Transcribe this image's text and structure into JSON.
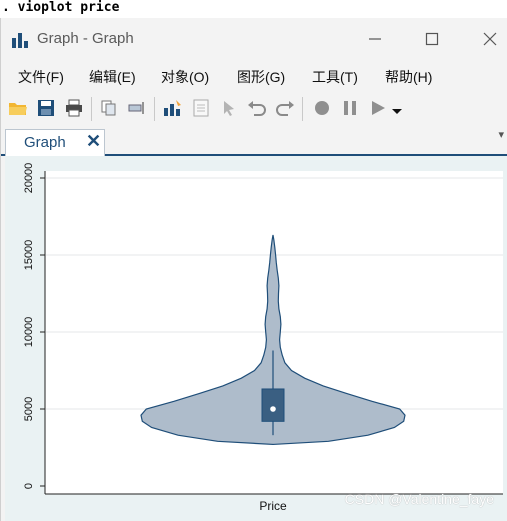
{
  "console": {
    "command": ". vioplot price"
  },
  "window": {
    "title": "Graph - Graph"
  },
  "menu": [
    "文件(F)",
    "编辑(E)",
    "对象(O)",
    "图形(G)",
    "工具(T)",
    "帮助(H)"
  ],
  "tab": {
    "label": "Graph",
    "close": "✕"
  },
  "watermark": "CSDN @Valentine_faye",
  "chart_data": {
    "type": "violin",
    "title": "",
    "xlabel": "Price",
    "ylabel": "",
    "ylim": [
      0,
      20000
    ],
    "yticks": [
      0,
      5000,
      10000,
      15000,
      20000
    ],
    "ytick_labels": [
      "0",
      "5000",
      "10000",
      "15000",
      "20000"
    ],
    "grid": true,
    "series": [
      {
        "name": "Price",
        "box": {
          "q1": 4200,
          "median": 5000,
          "q3": 6300,
          "whisker_low": 3300,
          "whisker_high": 8800
        },
        "density_profile": [
          [
            2700,
            0.0
          ],
          [
            2900,
            0.42
          ],
          [
            3300,
            0.72
          ],
          [
            3800,
            0.92
          ],
          [
            4200,
            0.99
          ],
          [
            4600,
            1.0
          ],
          [
            5000,
            0.96
          ],
          [
            5500,
            0.75
          ],
          [
            6000,
            0.56
          ],
          [
            6500,
            0.38
          ],
          [
            7000,
            0.24
          ],
          [
            7500,
            0.14
          ],
          [
            8000,
            0.09
          ],
          [
            8500,
            0.07
          ],
          [
            9000,
            0.055
          ],
          [
            9500,
            0.05
          ],
          [
            10000,
            0.055
          ],
          [
            10500,
            0.06
          ],
          [
            11000,
            0.055
          ],
          [
            11500,
            0.045
          ],
          [
            12000,
            0.04
          ],
          [
            12500,
            0.042
          ],
          [
            13000,
            0.045
          ],
          [
            13500,
            0.04
          ],
          [
            14000,
            0.032
          ],
          [
            14500,
            0.025
          ],
          [
            15000,
            0.02
          ],
          [
            15500,
            0.014
          ],
          [
            16000,
            0.006
          ],
          [
            16300,
            0.0
          ]
        ]
      }
    ],
    "colors": {
      "violin_fill": "#aebccb",
      "violin_stroke": "#1f4e79",
      "box_fill": "#3a5f82",
      "grid": "#e4e7ea"
    }
  }
}
